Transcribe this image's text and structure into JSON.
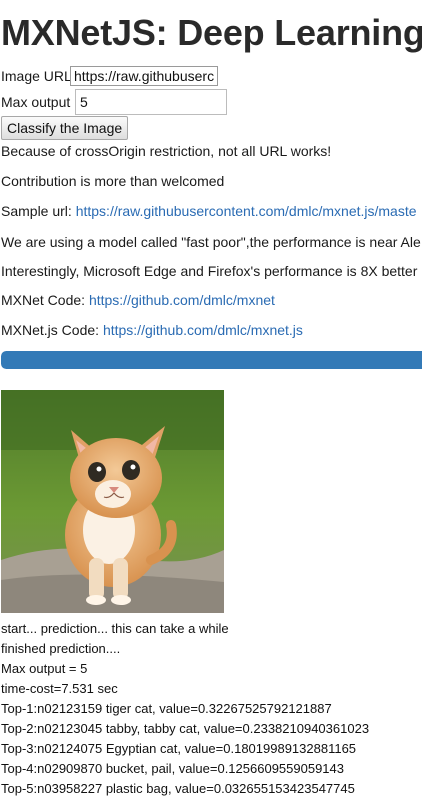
{
  "title": "MXNetJS: Deep Learning",
  "form": {
    "url_label": "Image URL",
    "url_value": "https://raw.githubuserco",
    "max_label": "Max output",
    "max_value": "5",
    "classify_label": "Classify the Image"
  },
  "notes": {
    "cors": "Because of crossOrigin restriction, not all URL works!",
    "contribution": "Contribution is more than welcomed",
    "sample_prefix": "Sample url: ",
    "sample_link": "https://raw.githubusercontent.com/dmlc/mxnet.js/maste",
    "model": "We are using a model called \"fast poor\",the performance is near Ale",
    "perf": "Interestingly, Microsoft Edge and Firefox's performance is 8X better",
    "mxnet_prefix": "MXNet Code: ",
    "mxnet_link": "https://github.com/dmlc/mxnet",
    "mxnetjs_prefix": "MXNet.js Code: ",
    "mxnetjs_link": "https://github.com/dmlc/mxnet.js"
  },
  "progress": {
    "value": 1.0,
    "color": "#337ab7"
  },
  "output": {
    "lines": [
      "start... prediction... this can take a while",
      "finished prediction....",
      "Max output = 5",
      "time-cost=7.531 sec",
      "Top-1:n02123159 tiger cat, value=0.32267525792121887",
      "Top-2:n02123045 tabby, tabby cat, value=0.2338210940361023",
      "Top-3:n02124075 Egyptian cat, value=0.18019989132881165",
      "Top-4:n02909870 bucket, pail, value=0.1256609559059143",
      "Top-5:n03958227 plastic bag, value=0.032655153423547745"
    ]
  }
}
